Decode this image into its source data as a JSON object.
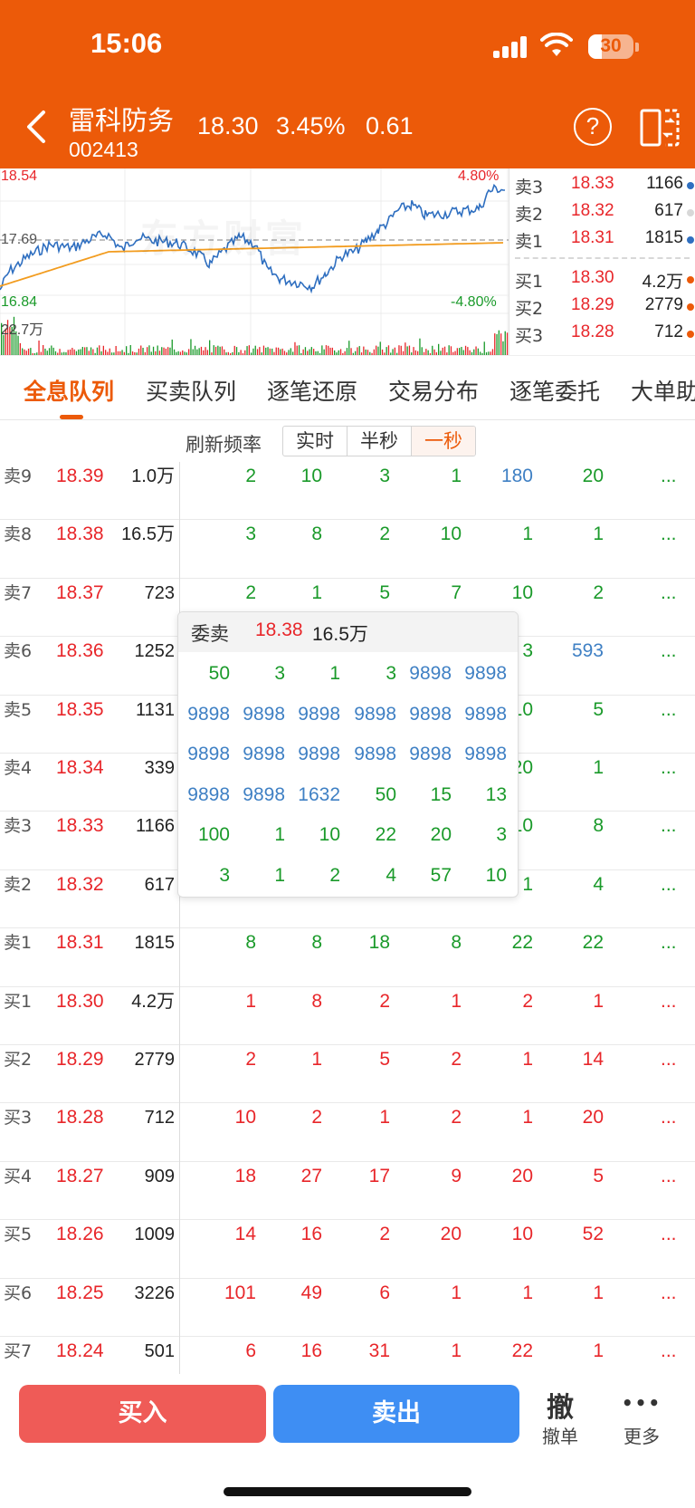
{
  "status_bar": {
    "time": "15:06",
    "battery": "30"
  },
  "header": {
    "stock_name": "雷科防务",
    "stock_code": "002413",
    "price": "18.30",
    "change_pct": "3.45%",
    "change": "0.61",
    "help_label": "?"
  },
  "chart": {
    "high_label": "18.54",
    "prev_close_label": "17.69",
    "low_label": "16.84",
    "up_pct_label": "4.80%",
    "down_pct_label": "-4.80%",
    "volume_label": "22.7万",
    "watermark": "东方财富",
    "colors": {
      "price_line": "#2f6fc0",
      "avg_line": "#f29c1f",
      "up": "#e8262a",
      "down": "#1a9a2a"
    }
  },
  "quote5": [
    {
      "label": "卖3",
      "price": "18.33",
      "vol": "1166",
      "dot": "#2f6fc0"
    },
    {
      "label": "卖2",
      "price": "18.32",
      "vol": "617",
      "dot": "#d8d8d8"
    },
    {
      "label": "卖1",
      "price": "18.31",
      "vol": "1815",
      "dot": "#2f6fc0"
    },
    {
      "label": "买1",
      "price": "18.30",
      "vol": "4.2万",
      "dot": "#ec5a09"
    },
    {
      "label": "买2",
      "price": "18.29",
      "vol": "2779",
      "dot": "#ec5a09"
    },
    {
      "label": "买3",
      "price": "18.28",
      "vol": "712",
      "dot": "#ec5a09"
    }
  ],
  "tabs": [
    "全息队列",
    "买卖队列",
    "逐笔还原",
    "交易分布",
    "逐笔委托",
    "大单助手"
  ],
  "refresh": {
    "label": "刷新频率",
    "options": [
      "实时",
      "半秒",
      "一秒"
    ],
    "selected": 2
  },
  "queue": [
    {
      "level": "卖9",
      "price": "18.39",
      "vol": "1.0万",
      "orders": [
        [
          "2",
          "g"
        ],
        [
          "10",
          "g"
        ],
        [
          "3",
          "g"
        ],
        [
          "1",
          "g"
        ],
        [
          "180",
          "b"
        ],
        [
          "20",
          "g"
        ]
      ]
    },
    {
      "level": "卖8",
      "price": "18.38",
      "vol": "16.5万",
      "orders": [
        [
          "3",
          "g"
        ],
        [
          "8",
          "g"
        ],
        [
          "2",
          "g"
        ],
        [
          "10",
          "g"
        ],
        [
          "1",
          "g"
        ],
        [
          "1",
          "g"
        ]
      ]
    },
    {
      "level": "卖7",
      "price": "18.37",
      "vol": "723",
      "orders": [
        [
          "2",
          "g"
        ],
        [
          "1",
          "g"
        ],
        [
          "5",
          "g"
        ],
        [
          "7",
          "g"
        ],
        [
          "10",
          "g"
        ],
        [
          "2",
          "g"
        ]
      ]
    },
    {
      "level": "卖6",
      "price": "18.36",
      "vol": "1252",
      "orders": [
        [
          "",
          "g"
        ],
        [
          "",
          "g"
        ],
        [
          "",
          "g"
        ],
        [
          "",
          "g"
        ],
        [
          "3",
          "g"
        ],
        [
          "593",
          "b"
        ]
      ]
    },
    {
      "level": "卖5",
      "price": "18.35",
      "vol": "1131",
      "orders": [
        [
          "",
          "g"
        ],
        [
          "",
          "g"
        ],
        [
          "",
          "g"
        ],
        [
          "",
          "g"
        ],
        [
          "10",
          "g"
        ],
        [
          "5",
          "g"
        ]
      ]
    },
    {
      "level": "卖4",
      "price": "18.34",
      "vol": "339",
      "orders": [
        [
          "",
          "g"
        ],
        [
          "",
          "g"
        ],
        [
          "",
          "g"
        ],
        [
          "",
          "g"
        ],
        [
          "20",
          "g"
        ],
        [
          "1",
          "g"
        ]
      ]
    },
    {
      "level": "卖3",
      "price": "18.33",
      "vol": "1166",
      "orders": [
        [
          "",
          "g"
        ],
        [
          "",
          "g"
        ],
        [
          "",
          "g"
        ],
        [
          "",
          "g"
        ],
        [
          "10",
          "g"
        ],
        [
          "8",
          "g"
        ]
      ]
    },
    {
      "level": "卖2",
      "price": "18.32",
      "vol": "617",
      "orders": [
        [
          "",
          "g"
        ],
        [
          "",
          "g"
        ],
        [
          "",
          "g"
        ],
        [
          "",
          "g"
        ],
        [
          "1",
          "g"
        ],
        [
          "4",
          "g"
        ]
      ]
    },
    {
      "level": "卖1",
      "price": "18.31",
      "vol": "1815",
      "orders": [
        [
          "8",
          "g"
        ],
        [
          "8",
          "g"
        ],
        [
          "18",
          "g"
        ],
        [
          "8",
          "g"
        ],
        [
          "22",
          "g"
        ],
        [
          "22",
          "g"
        ]
      ]
    },
    {
      "level": "买1",
      "price": "18.30",
      "vol": "4.2万",
      "orders": [
        [
          "1",
          "r"
        ],
        [
          "8",
          "r"
        ],
        [
          "2",
          "r"
        ],
        [
          "1",
          "r"
        ],
        [
          "2",
          "r"
        ],
        [
          "1",
          "r"
        ]
      ]
    },
    {
      "level": "买2",
      "price": "18.29",
      "vol": "2779",
      "orders": [
        [
          "2",
          "r"
        ],
        [
          "1",
          "r"
        ],
        [
          "5",
          "r"
        ],
        [
          "2",
          "r"
        ],
        [
          "1",
          "r"
        ],
        [
          "14",
          "r"
        ]
      ]
    },
    {
      "level": "买3",
      "price": "18.28",
      "vol": "712",
      "orders": [
        [
          "10",
          "r"
        ],
        [
          "2",
          "r"
        ],
        [
          "1",
          "r"
        ],
        [
          "2",
          "r"
        ],
        [
          "1",
          "r"
        ],
        [
          "20",
          "r"
        ]
      ]
    },
    {
      "level": "买4",
      "price": "18.27",
      "vol": "909",
      "orders": [
        [
          "18",
          "r"
        ],
        [
          "27",
          "r"
        ],
        [
          "17",
          "r"
        ],
        [
          "9",
          "r"
        ],
        [
          "20",
          "r"
        ],
        [
          "5",
          "r"
        ]
      ]
    },
    {
      "level": "买5",
      "price": "18.26",
      "vol": "1009",
      "orders": [
        [
          "14",
          "r"
        ],
        [
          "16",
          "r"
        ],
        [
          "2",
          "r"
        ],
        [
          "20",
          "r"
        ],
        [
          "10",
          "r"
        ],
        [
          "52",
          "r"
        ]
      ]
    },
    {
      "level": "买6",
      "price": "18.25",
      "vol": "3226",
      "orders": [
        [
          "101",
          "r"
        ],
        [
          "49",
          "r"
        ],
        [
          "6",
          "r"
        ],
        [
          "1",
          "r"
        ],
        [
          "1",
          "r"
        ],
        [
          "1",
          "r"
        ]
      ]
    },
    {
      "level": "买7",
      "price": "18.24",
      "vol": "501",
      "orders": [
        [
          "6",
          "r"
        ],
        [
          "16",
          "r"
        ],
        [
          "31",
          "r"
        ],
        [
          "1",
          "r"
        ],
        [
          "22",
          "r"
        ],
        [
          "1",
          "r"
        ]
      ]
    }
  ],
  "more_label": "...",
  "popup": {
    "title": "委卖",
    "price": "18.38",
    "vol": "16.5万",
    "rows": [
      [
        [
          "50",
          "g"
        ],
        [
          "3",
          "g"
        ],
        [
          "1",
          "g"
        ],
        [
          "3",
          "g"
        ],
        [
          "9898",
          "b"
        ],
        [
          "9898",
          "b"
        ]
      ],
      [
        [
          "9898",
          "b"
        ],
        [
          "9898",
          "b"
        ],
        [
          "9898",
          "b"
        ],
        [
          "9898",
          "b"
        ],
        [
          "9898",
          "b"
        ],
        [
          "9898",
          "b"
        ]
      ],
      [
        [
          "9898",
          "b"
        ],
        [
          "9898",
          "b"
        ],
        [
          "9898",
          "b"
        ],
        [
          "9898",
          "b"
        ],
        [
          "9898",
          "b"
        ],
        [
          "9898",
          "b"
        ]
      ],
      [
        [
          "9898",
          "b"
        ],
        [
          "9898",
          "b"
        ],
        [
          "1632",
          "b"
        ],
        [
          "50",
          "g"
        ],
        [
          "15",
          "g"
        ],
        [
          "13",
          "g"
        ]
      ],
      [
        [
          "100",
          "g"
        ],
        [
          "1",
          "g"
        ],
        [
          "10",
          "g"
        ],
        [
          "22",
          "g"
        ],
        [
          "20",
          "g"
        ],
        [
          "3",
          "g"
        ]
      ],
      [
        [
          "3",
          "g"
        ],
        [
          "1",
          "g"
        ],
        [
          "2",
          "g"
        ],
        [
          "4",
          "g"
        ],
        [
          "57",
          "g"
        ],
        [
          "10",
          "g"
        ]
      ]
    ]
  },
  "bottom_bar": {
    "buy": "买入",
    "sell": "卖出",
    "cancel_icon": "撤",
    "cancel_label": "撤单",
    "more_icon": "•••",
    "more_label": "更多"
  }
}
